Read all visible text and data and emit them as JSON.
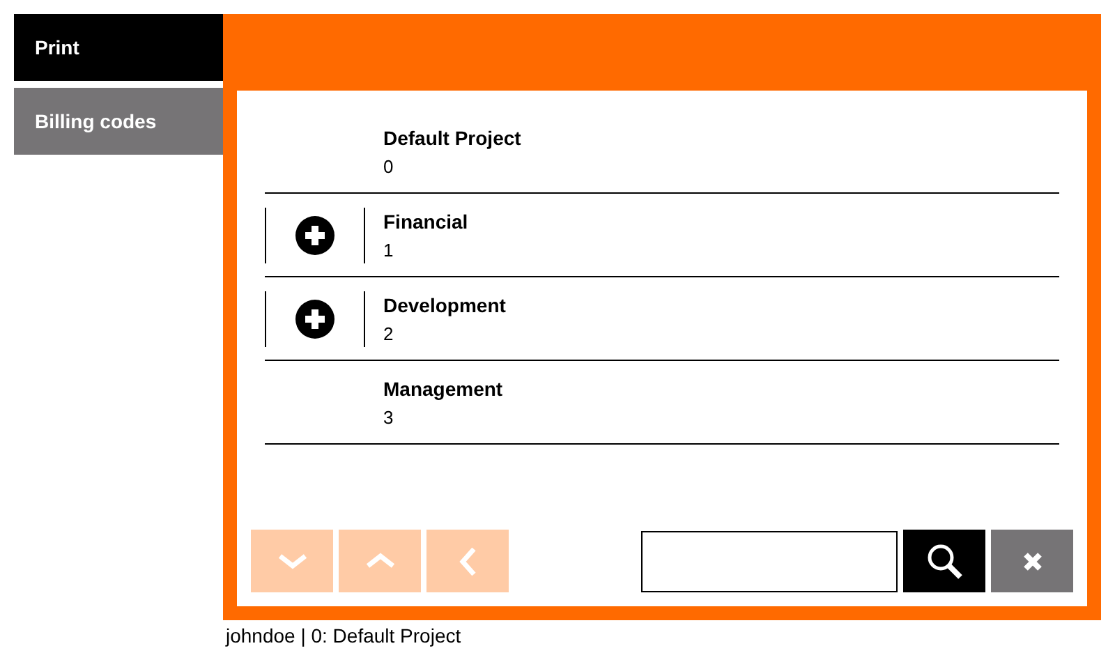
{
  "sidebar": {
    "items": [
      {
        "label": "Print",
        "selected": true
      },
      {
        "label": "Billing codes",
        "selected": false
      }
    ]
  },
  "list": {
    "rows": [
      {
        "name": "Default Project",
        "code": "0",
        "expandable": false
      },
      {
        "name": "Financial",
        "code": "1",
        "expandable": true
      },
      {
        "name": "Development",
        "code": "2",
        "expandable": true
      },
      {
        "name": "Management",
        "code": "3",
        "expandable": false
      }
    ]
  },
  "toolbar": {
    "nav_buttons": [
      {
        "kind": "down",
        "disabled": true
      },
      {
        "kind": "up",
        "disabled": true
      },
      {
        "kind": "back",
        "disabled": true
      }
    ]
  },
  "status_bar": {
    "text": "johndoe | 0: Default Project"
  }
}
